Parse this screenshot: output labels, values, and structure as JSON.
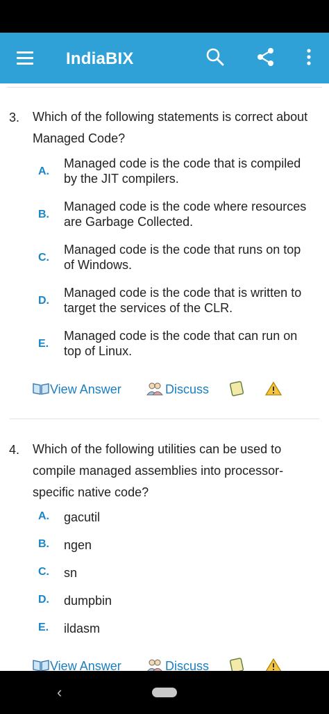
{
  "app": {
    "title": "IndiaBIX"
  },
  "questions": [
    {
      "number": "3.",
      "text_lines": [
        "Which of the following statements is correct about",
        "Managed Code?"
      ],
      "options": [
        {
          "letter": "A.",
          "lines": [
            "Managed code is the code that is compiled",
            "by the JIT compilers."
          ]
        },
        {
          "letter": "B.",
          "lines": [
            "Managed code is the code where resources",
            "are Garbage Collected."
          ]
        },
        {
          "letter": "C.",
          "lines": [
            "Managed code is the code that runs on top",
            "of Windows."
          ]
        },
        {
          "letter": "D.",
          "lines": [
            "Managed code is the code that is written to",
            "target the services of the CLR."
          ]
        },
        {
          "letter": "E.",
          "lines": [
            "Managed code is the code that can run on",
            "top of Linux."
          ]
        }
      ],
      "actions": {
        "view_answer": "View Answer",
        "discuss": "Discuss"
      }
    },
    {
      "number": "4.",
      "text_lines": [
        "Which of the following utilities can be used to",
        "compile managed assemblies into processor-",
        "specific native code?"
      ],
      "options": [
        {
          "letter": "A.",
          "lines": [
            "gacutil"
          ]
        },
        {
          "letter": "B.",
          "lines": [
            "ngen"
          ]
        },
        {
          "letter": "C.",
          "lines": [
            "sn"
          ]
        },
        {
          "letter": "D.",
          "lines": [
            "dumpbin"
          ]
        },
        {
          "letter": "E.",
          "lines": [
            "ildasm"
          ]
        }
      ],
      "actions": {
        "view_answer": "View Answer",
        "discuss": "Discuss"
      }
    }
  ],
  "nav": {
    "back_glyph": "‹"
  },
  "colors": {
    "app_bar": "#2fa1d6",
    "option_letter": "#1a86c8",
    "link": "#1a7ec0"
  }
}
